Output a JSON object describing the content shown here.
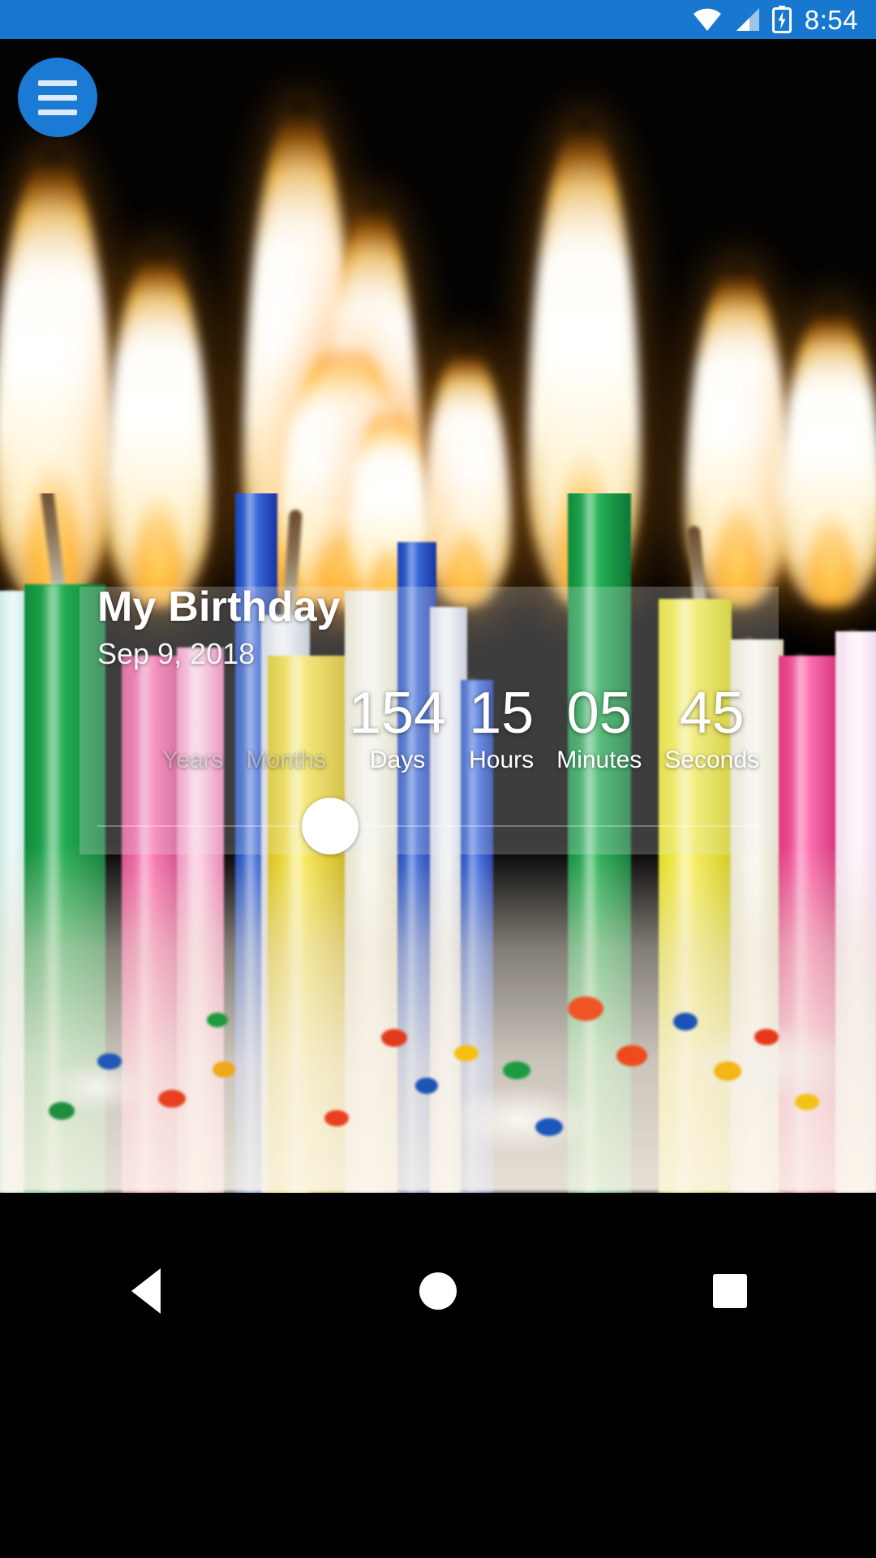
{
  "status_bar": {
    "time": "8:54",
    "background_color": "#1878cf",
    "icons": [
      "wifi-icon",
      "cellular-signal-icon",
      "battery-charging-icon"
    ]
  },
  "menu_button": {
    "icon": "hamburger-menu-icon",
    "color": "#1a7ad4"
  },
  "event_card": {
    "title": "My Birthday",
    "date": "Sep 9, 2018",
    "countdown": [
      {
        "value": "",
        "label": "Years",
        "active": false
      },
      {
        "value": "",
        "label": "Months",
        "active": false
      },
      {
        "value": "154",
        "label": "Days",
        "active": true
      },
      {
        "value": "15",
        "label": "Hours",
        "active": true
      },
      {
        "value": "05",
        "label": "Minutes",
        "active": true
      },
      {
        "value": "45",
        "label": "Seconds",
        "active": true
      }
    ],
    "slider": {
      "thumb_color": "#ffffff",
      "track_color": "rgba(255,255,255,0.30)"
    }
  },
  "background": {
    "description": "birthday-candles-photo"
  },
  "nav_bar": {
    "buttons": [
      {
        "name": "back-button",
        "icon": "triangle-back-icon"
      },
      {
        "name": "home-button",
        "icon": "circle-home-icon"
      },
      {
        "name": "recents-button",
        "icon": "square-recents-icon"
      }
    ]
  }
}
